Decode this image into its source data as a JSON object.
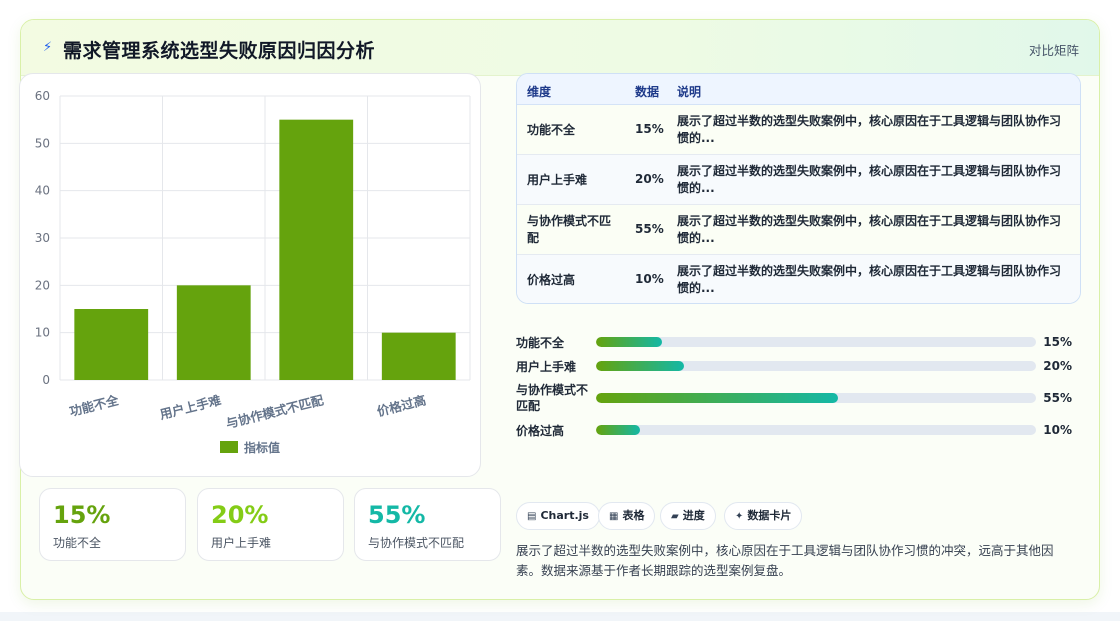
{
  "header": {
    "title": "需求管理系统选型失败原因归因分析",
    "tag": "对比矩阵"
  },
  "chart_data": {
    "type": "bar",
    "categories": [
      "功能不全",
      "用户上手难",
      "与协作模式不匹配",
      "价格过高"
    ],
    "series": [
      {
        "name": "指标值",
        "values": [
          15,
          20,
          55,
          10
        ]
      }
    ],
    "ylim": [
      0,
      60
    ],
    "yticks": [
      0,
      10,
      20,
      30,
      40,
      50,
      60
    ],
    "grid": true,
    "legend": "bottom",
    "bar_color": "#65a30d"
  },
  "stats": [
    {
      "value": "15%",
      "label": "功能不全",
      "color": "#65a30d"
    },
    {
      "value": "20%",
      "label": "用户上手难",
      "color": "#84cc16"
    },
    {
      "value": "55%",
      "label": "与协作模式不匹配",
      "color": "#14b8a6"
    }
  ],
  "table": {
    "headers": [
      "维度",
      "数据",
      "说明"
    ],
    "rows": [
      {
        "dim": "功能不全",
        "data": "15%",
        "desc": "展示了超过半数的选型失败案例中，核心原因在于工具逻辑与团队协作习惯的..."
      },
      {
        "dim": "用户上手难",
        "data": "20%",
        "desc": "展示了超过半数的选型失败案例中，核心原因在于工具逻辑与团队协作习惯的..."
      },
      {
        "dim": "与协作模式不匹配",
        "data": "55%",
        "desc": "展示了超过半数的选型失败案例中，核心原因在于工具逻辑与团队协作习惯的..."
      },
      {
        "dim": "价格过高",
        "data": "10%",
        "desc": "展示了超过半数的选型失败案例中，核心原因在于工具逻辑与团队协作习惯的..."
      }
    ]
  },
  "progress": [
    {
      "label": "功能不全",
      "value": "15%",
      "fraction": 0.15
    },
    {
      "label": "用户上手难",
      "value": "20%",
      "fraction": 0.2
    },
    {
      "label": "与协作模式不匹配",
      "value": "55%",
      "fraction": 0.55
    },
    {
      "label": "价格过高",
      "value": "10%",
      "fraction": 0.1
    }
  ],
  "chips": [
    {
      "icon": "chart-icon",
      "glyph": "▤",
      "label": "Chart.js"
    },
    {
      "icon": "table-icon",
      "glyph": "▦",
      "label": "表格"
    },
    {
      "icon": "progress-icon",
      "glyph": "▰",
      "label": "进度"
    },
    {
      "icon": "sparkle-icon",
      "glyph": "✦",
      "label": "数据卡片"
    }
  ],
  "summary": "展示了超过半数的选型失败案例中，核心原因在于工具逻辑与团队协作习惯的冲突，远高于其他因素。数据来源基于作者长期跟踪的选型案例复盘。"
}
